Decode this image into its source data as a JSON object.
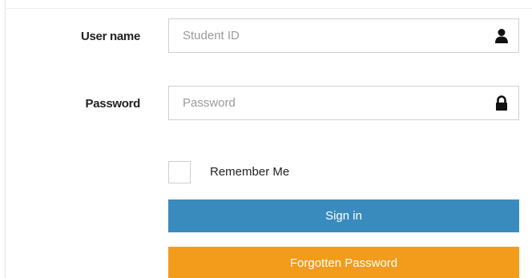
{
  "login": {
    "username": {
      "label": "User name",
      "placeholder": "Student ID",
      "value": "",
      "icon": "user-icon"
    },
    "password": {
      "label": "Password",
      "placeholder": "Password",
      "value": "",
      "icon": "lock-icon"
    },
    "remember": {
      "label": "Remember Me",
      "checked": false
    },
    "signin_label": "Sign in",
    "forgot_label": "Forgotten Password"
  },
  "colors": {
    "signin": "#3a8bbd",
    "forgot": "#f39c1b",
    "border": "#cfcfcf",
    "label_text": "#222222",
    "placeholder_text": "#9a9a9a"
  }
}
